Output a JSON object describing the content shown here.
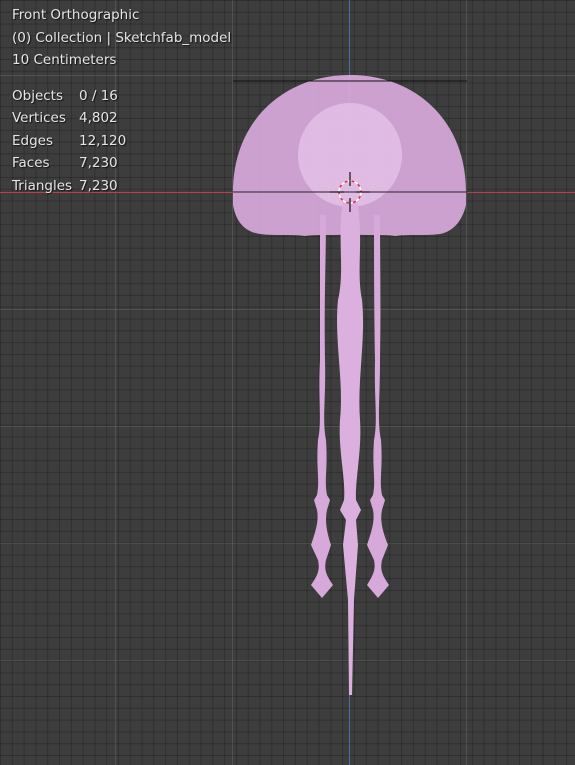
{
  "viewport": {
    "view_name": "Front Orthographic",
    "collection_label": "(0) Collection | Sketchfab_model",
    "scale_label": "10 Centimeters"
  },
  "stats": [
    {
      "label": "Objects",
      "value": "0 / 16"
    },
    {
      "label": "Vertices",
      "value": "4,802"
    },
    {
      "label": "Edges",
      "value": "12,120"
    },
    {
      "label": "Faces",
      "value": "7,230"
    },
    {
      "label": "Triangles",
      "value": "7,230"
    }
  ],
  "colors": {
    "background": "#3d3d3d",
    "x_axis": "#b8404a",
    "z_axis": "#4a6fa8",
    "model": "#dfb3e2"
  },
  "model": {
    "name": "jellyfish-mesh"
  },
  "cursor": {
    "name": "3d-cursor"
  }
}
